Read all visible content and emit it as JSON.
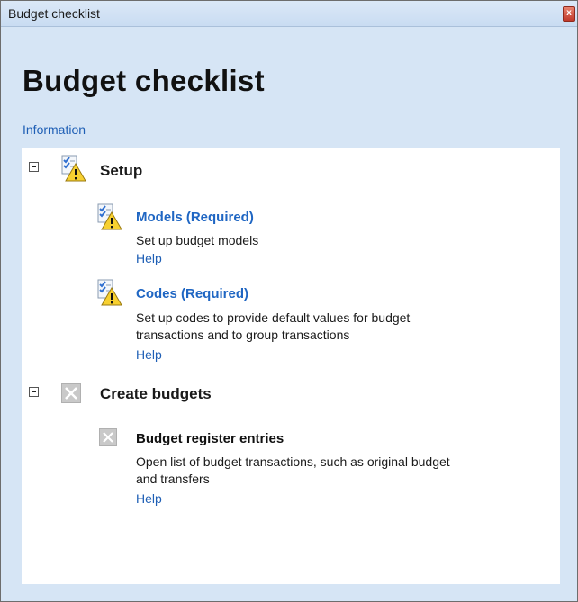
{
  "window": {
    "title": "Budget checklist",
    "close_label": "x"
  },
  "heading": "Budget checklist",
  "info_link": "Information",
  "groups": [
    {
      "title": "Setup",
      "icon": "checklist-warning-icon",
      "items": [
        {
          "title": "Models (Required)",
          "icon": "checklist-warning-icon",
          "description": "Set up budget models",
          "help": "Help"
        },
        {
          "title": "Codes (Required)",
          "icon": "checklist-warning-icon",
          "description_line1": "Set up codes to provide default values for budget",
          "description_line2": "transactions and to group transactions",
          "help": "Help"
        }
      ]
    },
    {
      "title": "Create budgets",
      "icon": "disabled-x-icon",
      "items": [
        {
          "title": "Budget register entries",
          "icon": "disabled-x-icon",
          "description_line1": "Open list of budget transactions, such as original budget",
          "description_line2": "and transfers",
          "help": "Help"
        }
      ]
    }
  ]
}
